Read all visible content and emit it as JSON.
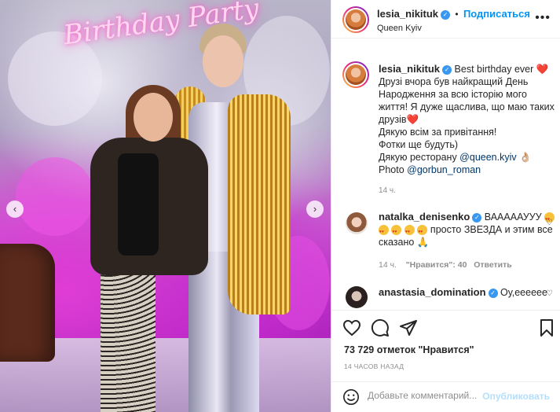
{
  "photo": {
    "neon_sign": "Birthday Party",
    "prev_arrow": "‹",
    "next_arrow": "›"
  },
  "header": {
    "username": "lesia_nikituk",
    "follow_label": "Подписаться",
    "separator": "•",
    "location": "Queen Kyiv",
    "more_label": "•••"
  },
  "caption": {
    "username": "lesia_nikituk",
    "line1": "Best birthday ever ❤️",
    "line2": "Друзі вчора був найкращий День Народження за всю історію мого життя! Я дуже щаслива, що маю таких друзів❤️",
    "line3": "Дякую всім за привітання!",
    "line4": "Фотки ще будуть)",
    "line5_prefix": "Дякую ресторану ",
    "line5_mention": "@queen.kyiv",
    "line5_suffix": " 👌🏼",
    "line6_prefix": "Photo ",
    "line6_mention": "@gorbun_roman",
    "age": "14 ч."
  },
  "comments": [
    {
      "username": "natalka_denisenko",
      "text_a": " ВАААААУУУ",
      "text_b": " просто ЗВЕЗДА и этим все сказано 🙏",
      "age": "14 ч.",
      "likes": "\"Нравится\": 40",
      "reply": "Ответить"
    },
    {
      "username": "anastasia_domination",
      "text": " Оу,еееeee"
    }
  ],
  "actions": {
    "likes": "73 729 отметок \"Нравится\"",
    "time": "14 ЧАСОВ НАЗАД"
  },
  "comment_box": {
    "placeholder": "Добавьте комментарий...",
    "publish_label": "Опубликовать"
  },
  "colors": {
    "accent": "#0095f6",
    "verified": "#3897f0",
    "mention": "#00376b",
    "muted": "#8e8e8e"
  }
}
